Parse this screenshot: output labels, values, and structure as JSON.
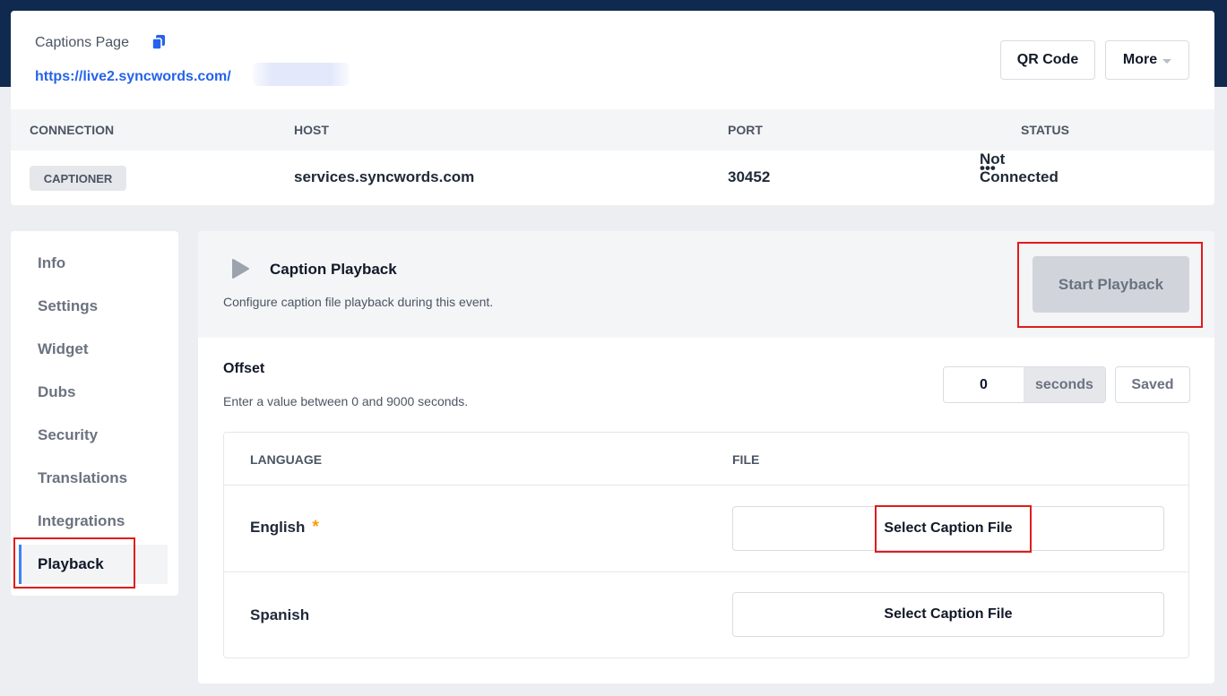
{
  "header": {
    "captions_label": "Captions Page",
    "captions_url": "https://live2.syncwords.com/",
    "qr_button": "QR Code",
    "more_button": "More"
  },
  "connection_table": {
    "columns": [
      "CONNECTION",
      "HOST",
      "PORT",
      "STATUS"
    ],
    "row": {
      "connection": "CAPTIONER",
      "host": "services.syncwords.com",
      "port": "30452",
      "status_dots": "•••",
      "status": "Not Connected"
    }
  },
  "sidebar": {
    "items": [
      {
        "label": "Info"
      },
      {
        "label": "Settings"
      },
      {
        "label": "Widget"
      },
      {
        "label": "Dubs"
      },
      {
        "label": "Security"
      },
      {
        "label": "Translations"
      },
      {
        "label": "Integrations"
      },
      {
        "label": "Playback"
      }
    ],
    "active": "Playback"
  },
  "playback": {
    "title": "Caption Playback",
    "description": "Configure caption file playback during this event.",
    "start_button": "Start Playback",
    "offset": {
      "label": "Offset",
      "help": "Enter a value between 0 and 9000 seconds.",
      "value": "0",
      "unit": "seconds",
      "saved_label": "Saved"
    },
    "languages": {
      "columns": [
        "LANGUAGE",
        "FILE"
      ],
      "rows": [
        {
          "language": "English",
          "required": "*",
          "file_button": "Select Caption File"
        },
        {
          "language": "Spanish",
          "file_button": "Select Caption File"
        }
      ]
    }
  },
  "colors": {
    "brand_dark": "#0f2a4e",
    "link": "#2563eb",
    "warning": "#f59e0b",
    "active_indicator": "#3b82f6",
    "highlight": "#e21b1b"
  }
}
